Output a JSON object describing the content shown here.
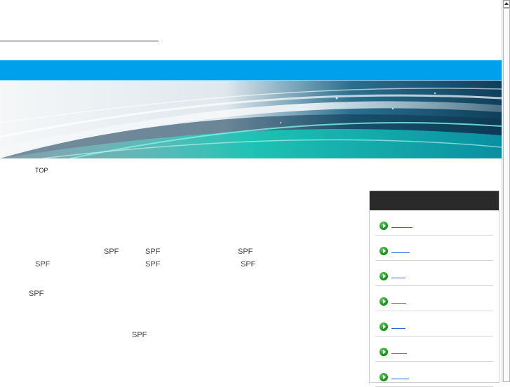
{
  "breadcrumb": {
    "top_label": "TOP"
  },
  "content": {
    "spf_mentions": [
      "SPF",
      "SPF",
      "SPF",
      "SPF",
      "SPF",
      "SPF",
      "SPF",
      "SPF"
    ]
  },
  "sidebar": {
    "items": [
      {
        "link_text": ""
      },
      {
        "link_text": ""
      },
      {
        "link_text": ""
      },
      {
        "link_text": ""
      },
      {
        "link_text": ""
      },
      {
        "link_text": ""
      },
      {
        "link_text": ""
      }
    ]
  },
  "colors": {
    "nav_bar": "#00a0ec",
    "sidebar_header": "#2a2a2a",
    "bullet": "#1b9a1b",
    "link": "#2a6bd1"
  },
  "icons": {
    "bullet": "green-play-circle-icon",
    "scroll_up": "scroll-up-arrow-icon"
  }
}
